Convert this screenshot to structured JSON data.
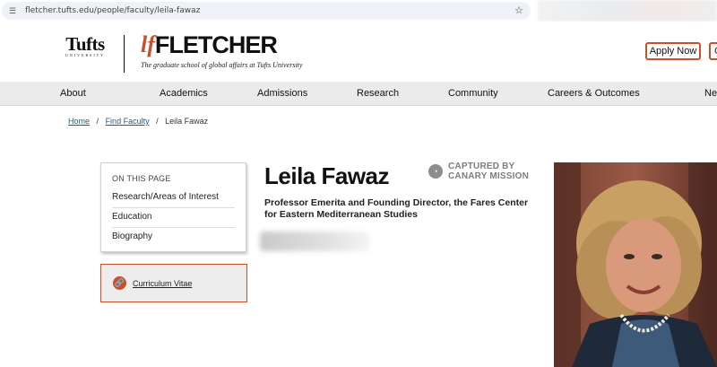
{
  "browser": {
    "url": "fletcher.tufts.edu/people/faculty/leila-fawaz"
  },
  "header": {
    "tufts_logo": "Tufts",
    "tufts_sub": "UNIVERSITY",
    "fletcher_mark": "lf",
    "fletcher_word": "FLETCHER",
    "fletcher_tagline": "The graduate school of global affairs at Tufts University",
    "apply_label": "Apply Now",
    "next_label": "G"
  },
  "nav": {
    "items": [
      {
        "label": "About"
      },
      {
        "label": "Academics"
      },
      {
        "label": "Admissions"
      },
      {
        "label": "Research"
      },
      {
        "label": "Community"
      },
      {
        "label": "Careers & Outcomes"
      },
      {
        "label": "Ne"
      }
    ]
  },
  "breadcrumb": {
    "home": "Home",
    "find_faculty": "Find Faculty",
    "current": "Leila Fawaz",
    "sep": "/"
  },
  "on_this_page": {
    "title": "ON THIS PAGE",
    "items": [
      {
        "label": "Research/Areas of Interest"
      },
      {
        "label": "Education"
      },
      {
        "label": "Biography"
      }
    ]
  },
  "cv": {
    "label": "Curriculum Vitae"
  },
  "profile": {
    "name": "Leila Fawaz",
    "title": "Professor Emerita and Founding Director, the Fares Center for Eastern Mediterranean Studies"
  },
  "watermark": {
    "line1": "CAPTURED BY",
    "line2": "CANARY MISSION"
  },
  "colors": {
    "accent": "#c8502a",
    "nav_bg": "#ebebeb",
    "link": "#1f5c8f"
  }
}
